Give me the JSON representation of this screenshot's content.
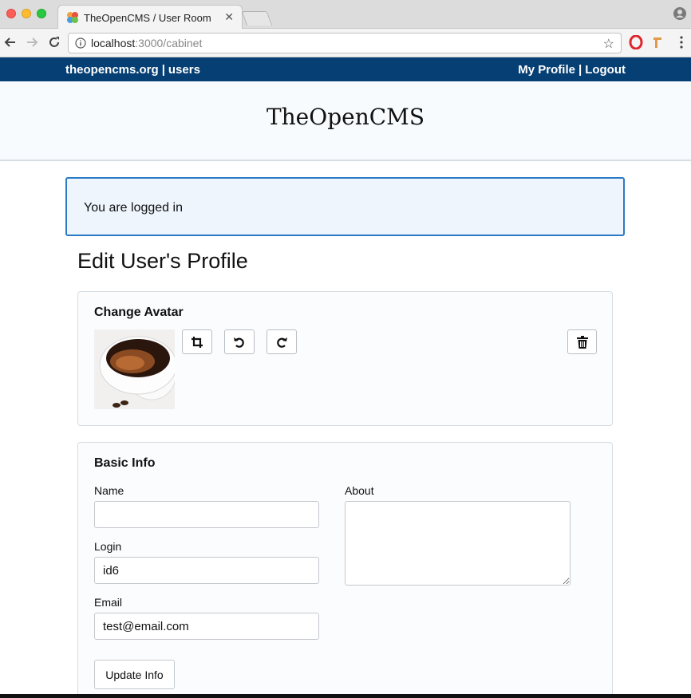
{
  "browser": {
    "tab_title": "TheOpenCMS / User Room",
    "url_host": "localhost",
    "url_path": ":3000/cabinet"
  },
  "nav": {
    "left_site": "theopencms.org",
    "left_users": "users",
    "right_profile": "My Profile",
    "right_logout": "Logout",
    "separator": "|"
  },
  "brand": {
    "title": "TheOpenCMS"
  },
  "alert": {
    "message": "You are logged in"
  },
  "page": {
    "heading": "Edit User's Profile"
  },
  "avatar_card": {
    "title": "Change Avatar",
    "buttons": [
      "crop-icon",
      "rotate-left-icon",
      "rotate-right-icon",
      "trash-icon"
    ]
  },
  "basic_info": {
    "title": "Basic Info",
    "name_label": "Name",
    "name_value": "",
    "login_label": "Login",
    "login_value": "id6",
    "email_label": "Email",
    "email_value": "test@email.com",
    "about_label": "About",
    "about_value": "",
    "submit_label": "Update Info"
  },
  "colors": {
    "nav_bg": "#063f73",
    "alert_border": "#2a7ac6",
    "alert_bg": "#eef5fd"
  }
}
